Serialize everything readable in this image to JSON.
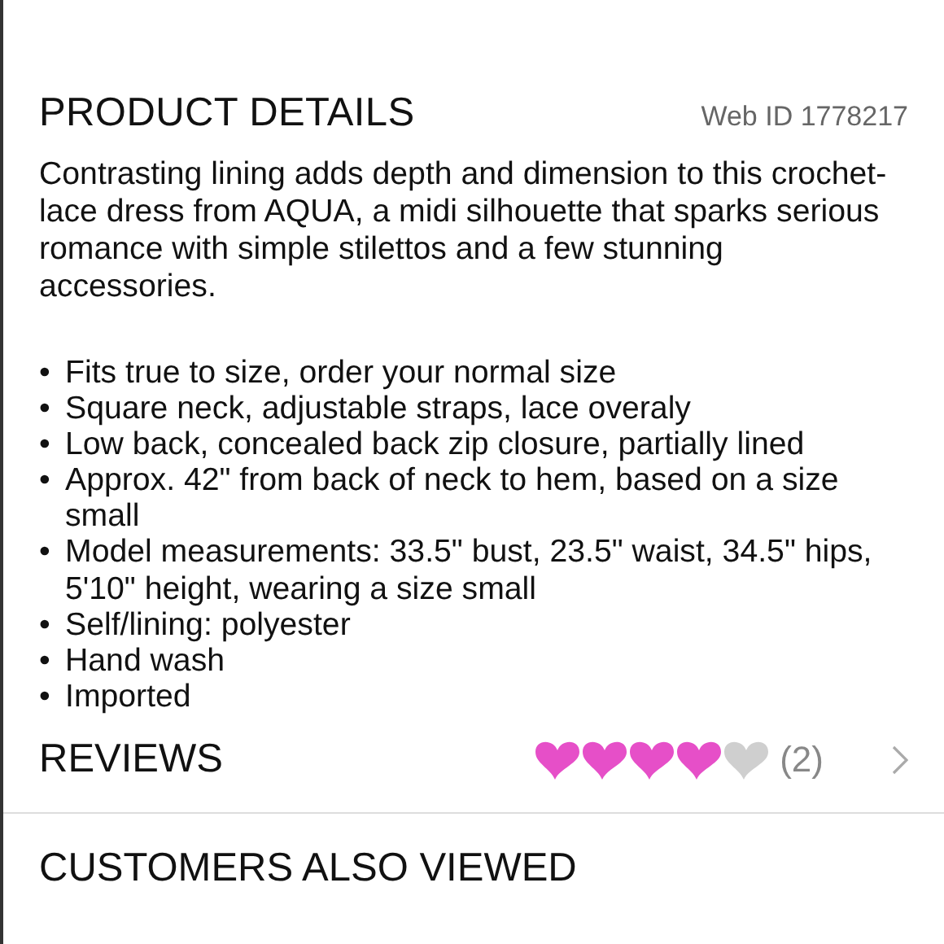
{
  "product_details": {
    "title": "PRODUCT DETAILS",
    "web_id": "Web ID 1778217",
    "description": "Contrasting lining adds depth and dimension to this crochet-lace dress from AQUA, a midi silhouette that sparks serious romance with simple stilettos and a few stunning accessories.",
    "bullets": [
      {
        "marker": "•",
        "text": "Fits true to size, order your normal size"
      },
      {
        "marker": "•",
        "text": "Square neck, adjustable straps, lace overaly"
      },
      {
        "marker": "•",
        "text": "Low back, concealed back zip closure, partially lined"
      },
      {
        "marker": "•",
        "text": "Approx. 42\" from back of neck to hem, based on a size small"
      },
      {
        "marker": "•",
        "text": "Model measurements: 33.5\" bust, 23.5\" waist, 34.5\" hips, 5'10\" height, wearing a size small"
      },
      {
        "marker": "•",
        "text": "Self/lining: polyester"
      },
      {
        "marker": "•",
        "text": "Hand wash"
      },
      {
        "marker": "•",
        "text": "Imported"
      }
    ]
  },
  "reviews": {
    "title": "REVIEWS",
    "stars": 4,
    "count": "(2)"
  },
  "customers_also_viewed": {
    "title": "CUSTOMERS ALSO VIEWED"
  }
}
